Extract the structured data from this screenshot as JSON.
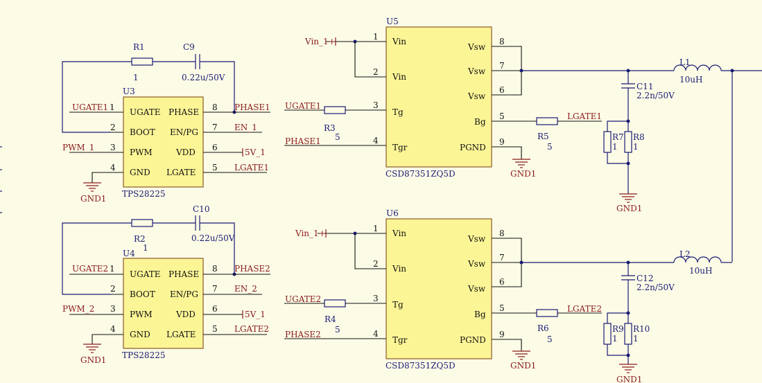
{
  "drivers": [
    {
      "designator": "U3",
      "part": "TPS28225",
      "pins_left": [
        {
          "num": "1",
          "name": "UGATE"
        },
        {
          "num": "2",
          "name": "BOOT"
        },
        {
          "num": "3",
          "name": "PWM"
        },
        {
          "num": "4",
          "name": "GND"
        }
      ],
      "pins_right": [
        {
          "num": "8",
          "name": "PHASE"
        },
        {
          "num": "7",
          "name": "EN/PG"
        },
        {
          "num": "6",
          "name": "VDD"
        },
        {
          "num": "5",
          "name": "LGATE"
        }
      ],
      "nets": {
        "ugate": "UGATE1",
        "pwm": "PWM_1",
        "phase": "PHASE1",
        "en": "EN_1",
        "vdd": "5V_1",
        "lgate": "LGATE1",
        "gnd": "GND1"
      },
      "r_boot": {
        "designator": "R1",
        "value": "1"
      },
      "c_boot": {
        "designator": "C9",
        "value": "0.22u/50V"
      }
    },
    {
      "designator": "U4",
      "part": "TPS28225",
      "pins_left": [
        {
          "num": "1",
          "name": "UGATE"
        },
        {
          "num": "2",
          "name": "BOOT"
        },
        {
          "num": "3",
          "name": "PWM"
        },
        {
          "num": "4",
          "name": "GND"
        }
      ],
      "pins_right": [
        {
          "num": "8",
          "name": "PHASE"
        },
        {
          "num": "7",
          "name": "EN/PG"
        },
        {
          "num": "6",
          "name": "VDD"
        },
        {
          "num": "5",
          "name": "LGATE"
        }
      ],
      "nets": {
        "ugate": "UGATE2",
        "pwm": "PWM_2",
        "phase": "PHASE2",
        "en": "EN_2",
        "vdd": "5V_1",
        "lgate": "LGATE2",
        "gnd": "GND1"
      },
      "r_boot": {
        "designator": "R2",
        "value": "1"
      },
      "c_boot": {
        "designator": "C10",
        "value": "0.22u/50V"
      }
    }
  ],
  "stages": [
    {
      "designator": "U5",
      "part": "CSD87351ZQ5D",
      "pins_left": [
        {
          "num": "1",
          "name": "Vin"
        },
        {
          "num": "2",
          "name": "Vin"
        },
        {
          "num": "3",
          "name": "Tg"
        },
        {
          "num": "4",
          "name": "Tgr"
        }
      ],
      "pins_right": [
        {
          "num": "8",
          "name": "Vsw"
        },
        {
          "num": "7",
          "name": "Vsw"
        },
        {
          "num": "6",
          "name": "Vsw"
        },
        {
          "num": "5",
          "name": "Bg"
        },
        {
          "num": "9",
          "name": "PGND"
        }
      ],
      "nets": {
        "vin": "Vin_1+",
        "ugate": "UGATE1",
        "phase": "PHASE1",
        "lgate": "LGATE1",
        "gnd": "GND1"
      },
      "r_gate": {
        "designator": "R3",
        "value": "5"
      },
      "r_low": {
        "designator": "R5",
        "value": "5"
      },
      "inductor": {
        "designator": "L1",
        "value": "10uH"
      },
      "snub_c": {
        "designator": "C11",
        "value": "2.2n/50V"
      },
      "snub_ra": {
        "designator": "R7",
        "value": "1"
      },
      "snub_rb": {
        "designator": "R8",
        "value": "1"
      },
      "snub_gnd": "GND1"
    },
    {
      "designator": "U6",
      "part": "CSD87351ZQ5D",
      "pins_left": [
        {
          "num": "1",
          "name": "Vin"
        },
        {
          "num": "2",
          "name": "Vin"
        },
        {
          "num": "3",
          "name": "Tg"
        },
        {
          "num": "4",
          "name": "Tgr"
        }
      ],
      "pins_right": [
        {
          "num": "8",
          "name": "Vsw"
        },
        {
          "num": "7",
          "name": "Vsw"
        },
        {
          "num": "6",
          "name": "Vsw"
        },
        {
          "num": "5",
          "name": "Bg"
        },
        {
          "num": "9",
          "name": "PGND"
        }
      ],
      "nets": {
        "vin": "Vin_1+",
        "ugate": "UGATE2",
        "phase": "PHASE2",
        "lgate": "LGATE2",
        "gnd": "GND1"
      },
      "r_gate": {
        "designator": "R4",
        "value": "5"
      },
      "r_low": {
        "designator": "R6",
        "value": "5"
      },
      "inductor": {
        "designator": "L2",
        "value": "10uH"
      },
      "snub_c": {
        "designator": "C12",
        "value": "2.2n/50V"
      },
      "snub_ra": {
        "designator": "R9",
        "value": "1"
      },
      "snub_rb": {
        "designator": "R10",
        "value": "1"
      },
      "snub_gnd": "GND1"
    }
  ],
  "colors": {
    "background": "#fbfbe6",
    "wire": "#1b1b75",
    "body": "#fcf596",
    "net_label": "#8b1a1a",
    "pin_text": "#111111"
  }
}
